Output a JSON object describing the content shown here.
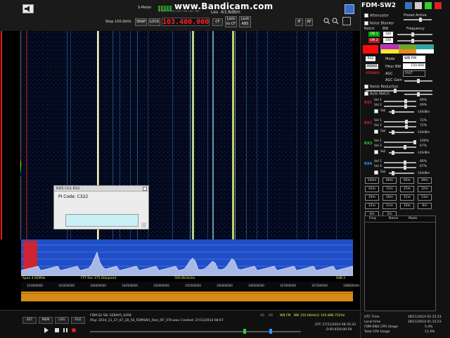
{
  "watermark": "www.Bandicam.com",
  "top": {
    "smeter_label": "S-Meter",
    "smeter_scale": "1  3  5  7  9 +10 +20 +30 +40 +50",
    "level": "Lev -63.8dBm",
    "step": "Step 100.0kHz",
    "snap": "SNAP",
    "lock": "LOCK",
    "frequency": "103.400.000",
    "cf": "CF",
    "lock_to_cf": "Lock to CF",
    "lock_abs": "Lock ABS",
    "if": "IF",
    "af": "AF"
  },
  "scale": {
    "top": "-72",
    "mid": "-107"
  },
  "rds": {
    "title": "RDS Ch1 RX2",
    "pi_code": "PI Code: C322"
  },
  "spectrum": {
    "span": "Span 4.92MHz",
    "fft": "FFT Res 375.0Hz/point",
    "div": "500.0kHz/div",
    "zoom": "0dB 2"
  },
  "freq_axis": [
    "103000000",
    "103500000",
    "104000000",
    "104500000",
    "105000000",
    "105500000",
    "106000000",
    "106500000",
    "107000000",
    "107500000",
    "108000000"
  ],
  "bottom": {
    "buttons": [
      "SET",
      "MEM",
      "LOG",
      "FILE"
    ],
    "device": "FDM-S2 SN. SE8AV5_0459",
    "play": "Play: 2014_11_27_07_20_56_FDMSW1_Reni_RF_07A.wav  Created: 27/11/2014 08:07",
    "sr": "SR",
    "ar": "AR",
    "mode": "WB FM",
    "bw": "BW 150.0kHz",
    "lo": "LO",
    "lo_freq": "105.886.752Hz",
    "utc": "UTC 27/11/2014 08:35:33",
    "elapsed": "0:00:45/0:00:59"
  },
  "panel": {
    "title": "FDM-SW2",
    "attenuator": "Attenuator",
    "preset_active": "Preset Active",
    "noise_blanker": "Noise Blanker",
    "notch": "Notch",
    "bw": "BW",
    "frequency": "Frequency",
    "on1": "ON 1",
    "on2": "ON 2",
    "notch_bw1": "100",
    "notch_bw2": "100",
    "rx2": "RX2",
    "mode_label": "Mode",
    "mode_value": "WB FM",
    "mono": "MONO",
    "filter_bw_label": "Filter BW",
    "filter_bw": "150.000",
    "stereo": "STEREO",
    "agc_label": "AGC",
    "agc_value": "FAST",
    "agc_gain": "AGC Gain",
    "noise_reduction": "Noise Reduction",
    "auto_notch": "Auto Notch",
    "rx_groups": [
      {
        "label": "RX1",
        "vol1": "Vol 1",
        "vol1_val": "69%",
        "vol2": "Vol 2",
        "vol2_val": "69%",
        "sql": "Sql",
        "sql_val": "-140dBm"
      },
      {
        "label": "RX2",
        "vol1": "Vol 1",
        "vol1_val": "72%",
        "vol2": "Vol 2",
        "vol2_val": "72%",
        "sql": "Sql",
        "sql_val": "-140dBm"
      },
      {
        "label": "RX3",
        "vol1": "Vol 1",
        "vol1_val": "100%",
        "vol2": "Vol 2",
        "vol2_val": "67%",
        "sql": "Sql",
        "sql_val": "-140dBm"
      },
      {
        "label": "RX4",
        "vol1": "Vol 1",
        "vol1_val": "66%",
        "vol2": "Vol 2",
        "vol2_val": "67%",
        "sql": "Sql",
        "sql_val": "-140dBm"
      }
    ],
    "bands": [
      "160m",
      "80m",
      "60m",
      "49m",
      "41m",
      "31m",
      "25m",
      "22m",
      "19m",
      "16m",
      "15m",
      "13m",
      "12m",
      "11m",
      "10m",
      "6m",
      "4m",
      "2m"
    ],
    "mem_headers": [
      "Freq",
      "Name",
      "Mode"
    ],
    "utc_time_label": "UTC Time",
    "utc_time": "28/11/2014 01:15:23",
    "local_time_label": "Local time",
    "local_time": "28/11/2014 01:15:23",
    "sw2_cpu_label": "FDM-SW2 CPU Usage",
    "sw2_cpu": "5.4%",
    "total_cpu_label": "Total CPU Usage",
    "total_cpu": "11.4%"
  }
}
